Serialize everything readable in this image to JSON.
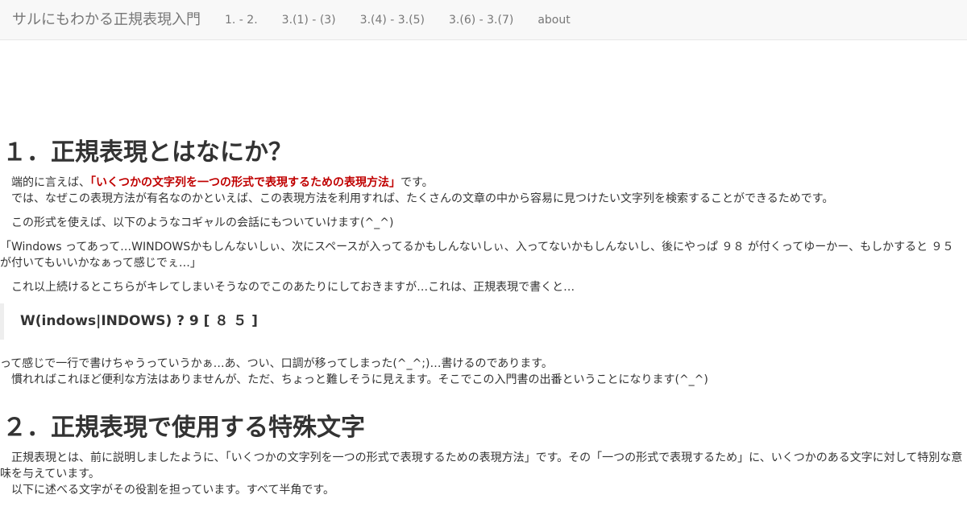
{
  "navbar": {
    "brand": "サルにもわかる正規表現入門",
    "links": [
      "1. - 2.",
      "3.(1) - (3)",
      "3.(4) - 3.(5)",
      "3.(6) - 3.(7)",
      "about"
    ]
  },
  "section1": {
    "heading": "１．正規表現とはなにか？",
    "p1_pre": "端的に言えば、",
    "p1_emphasis": "「いくつかの文字列を一つの形式で表現するための表現方法」",
    "p1_post": "です。",
    "p2": "では、なぜこの表現方法が有名なのかといえば、この表現方法を利用すれば、たくさんの文章の中から容易に見つけたい文字列を検索することができるためです。",
    "p3": "この形式を使えば、以下のようなコギャルの会話にもついていけます(^_^)",
    "quote": "「Windows ってあって…WINDOWSかもしんないしぃ、次にスペースが入ってるかもしんないしぃ、入ってないかもしんないし、後にやっぱ ９８ が付くってゆーかー、もしかすると ９５ が付いてもいいかなぁって感じでぇ…」",
    "p4": "これ以上続けるとこちらがキレてしまいそうなのでこのあたりにしておきますが…これは、正規表現で書くと…",
    "example": "W(indows|INDOWS) ? 9 [ ８ ５ ]",
    "p5": "って感じで一行で書けちゃうっていうかぁ…あ、つい、口調が移ってしまった(^_^;)…書けるのであります。",
    "p6": "慣れればこれほど便利な方法はありませんが、ただ、ちょっと難しそうに見えます。そこでこの入門書の出番ということになります(^_^)"
  },
  "section2": {
    "heading": "２．正規表現で使用する特殊文字",
    "p1": "正規表現とは、前に説明しましたように、「いくつかの文字列を一つの形式で表現するための表現方法」です。その「一つの形式で表現するため」に、いくつかのある文字に対して特別な意味を与えています。",
    "p2": "以下に述べる文字がその役割を担っています。すべて半角です。"
  }
}
